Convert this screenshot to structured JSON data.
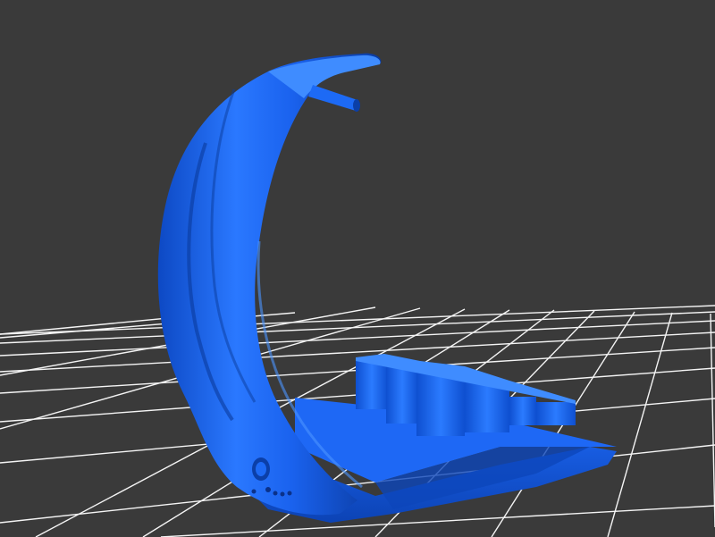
{
  "viewer": {
    "background": "#3a3a3a",
    "grid_color": "#ffffff",
    "model_color": "#1565f0",
    "model_highlight": "#3f8cff",
    "model_shadow": "#0b3fa8"
  }
}
